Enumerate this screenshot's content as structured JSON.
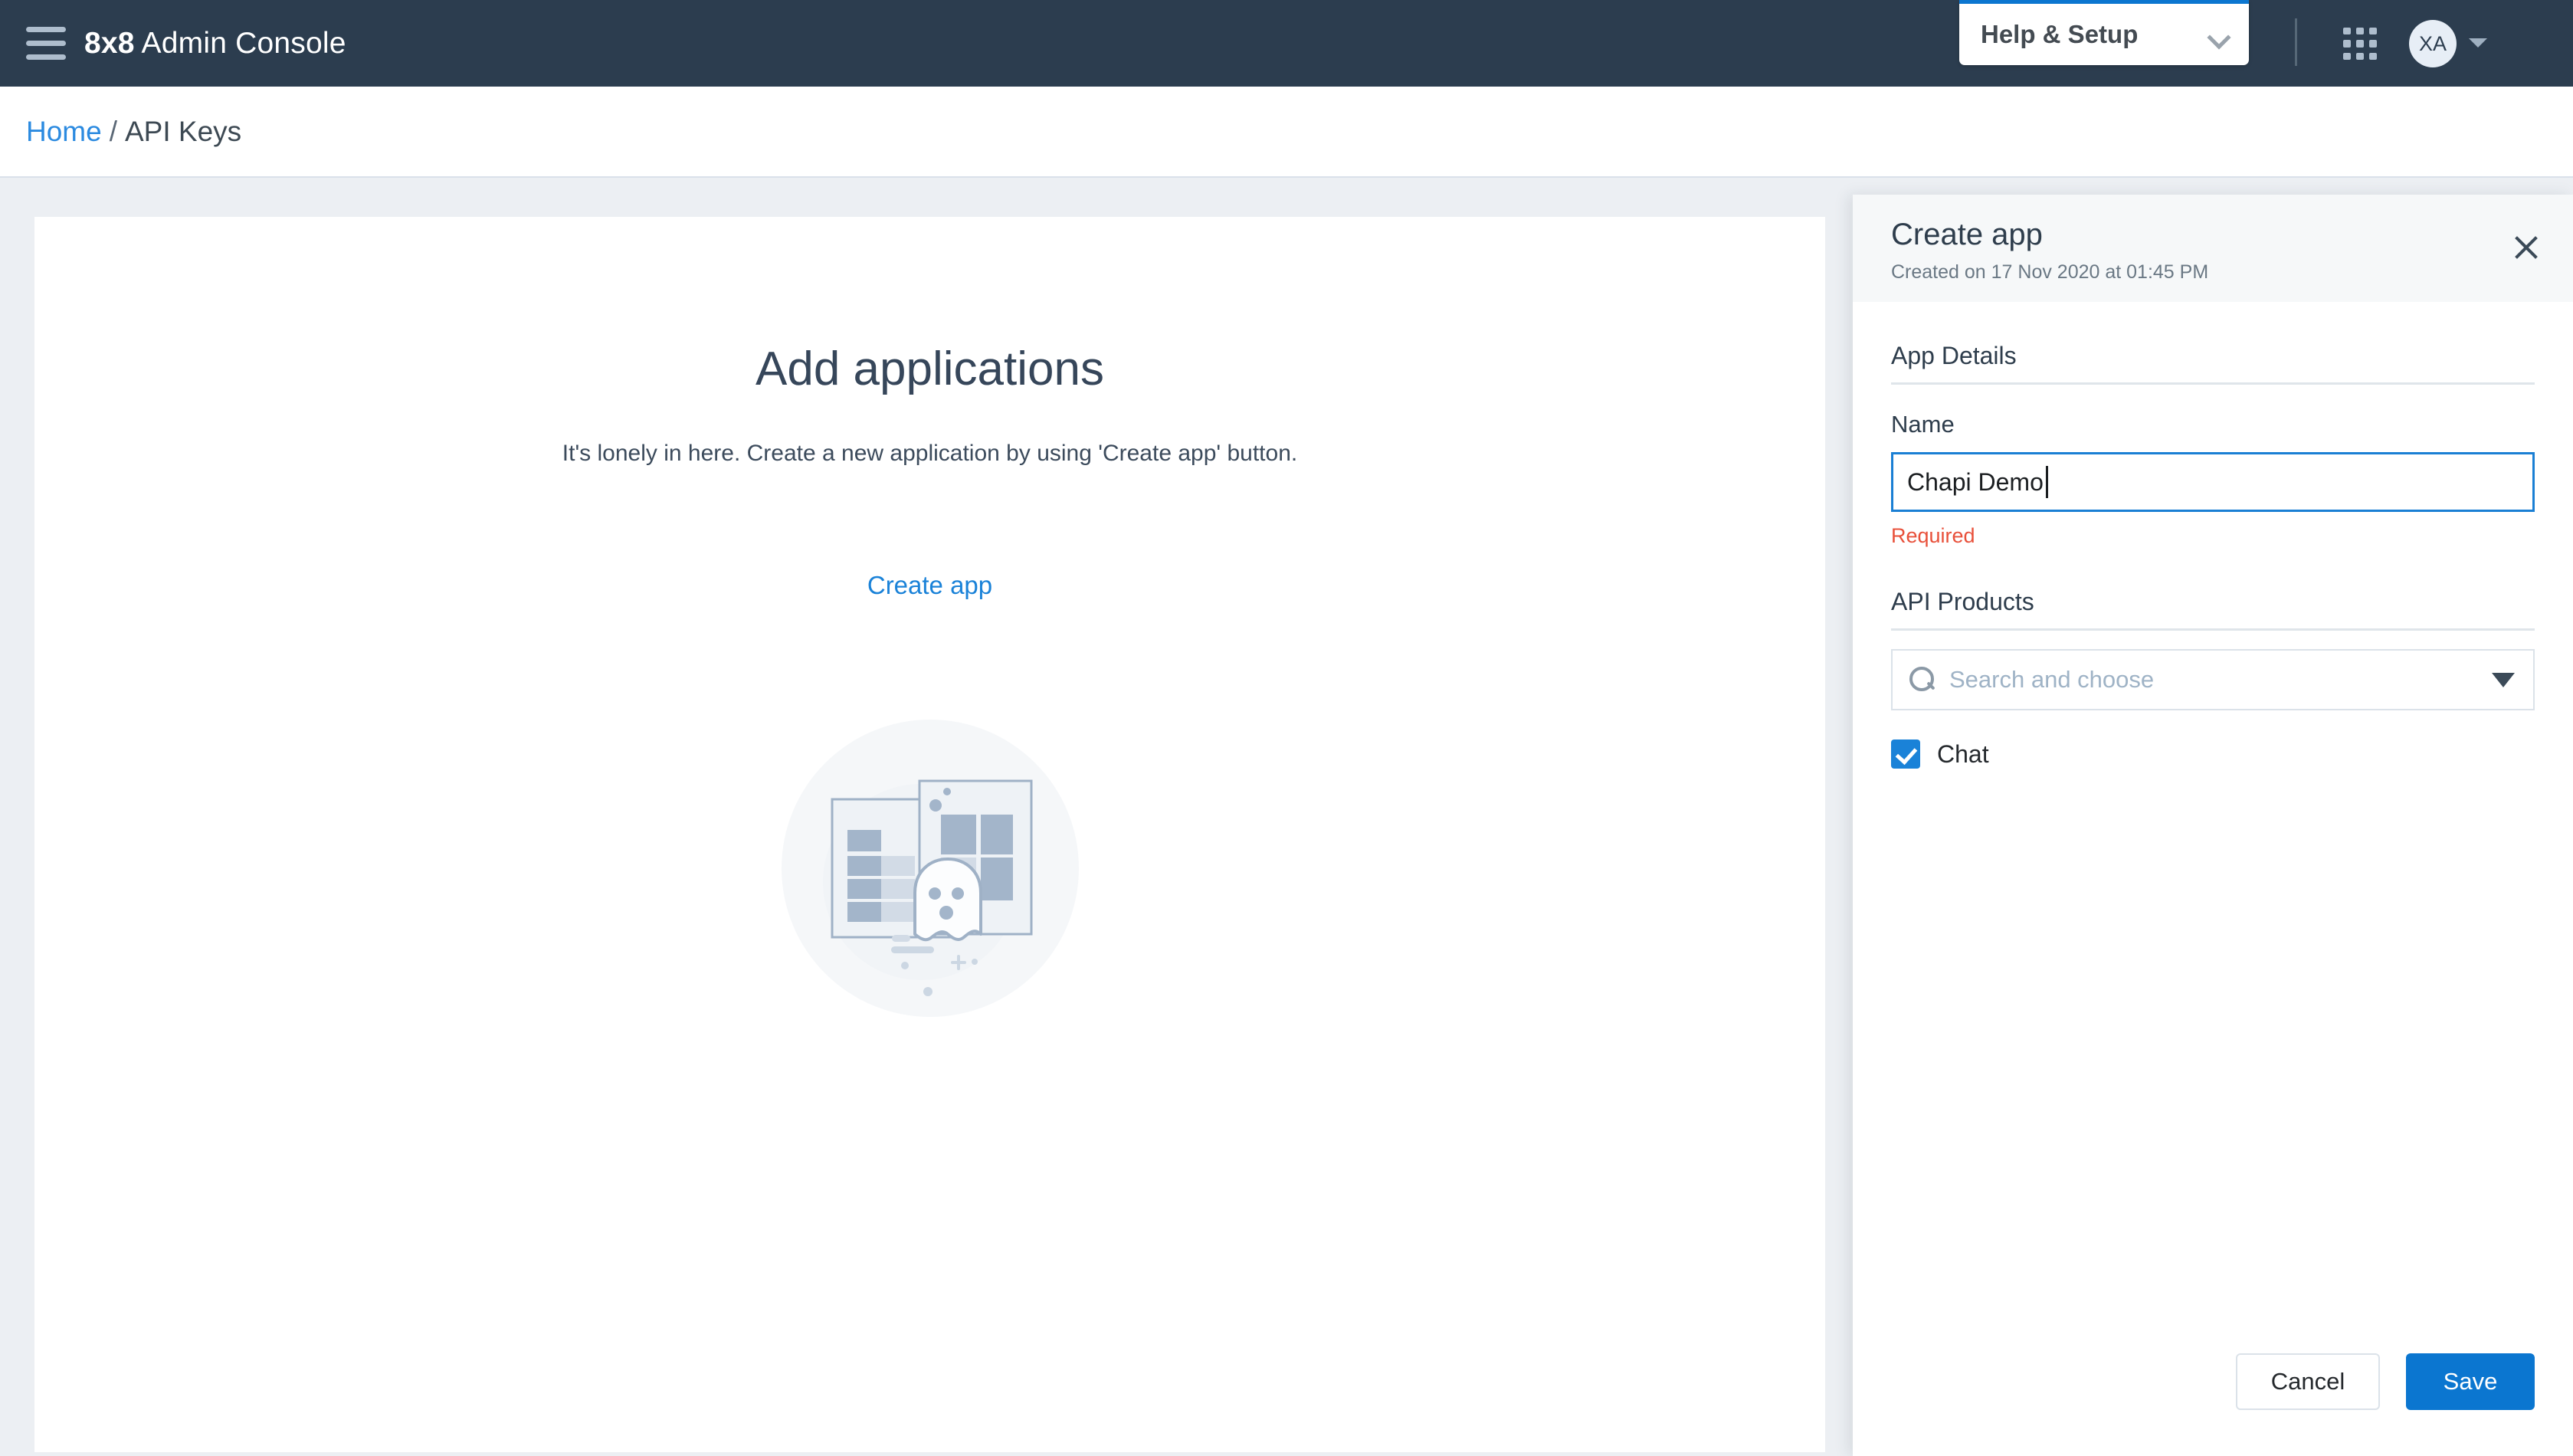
{
  "topbar": {
    "menu_icon": "hamburger-icon",
    "brand_bold": "8x8",
    "brand_light": " Admin Console",
    "help_setup_label": "Help & Setup",
    "help_setup_caret": "chevron-down-icon",
    "apps_grid_icon": "apps-grid-icon",
    "avatar_initials": "XA",
    "account_caret": "caret-down-icon"
  },
  "breadcrumb": {
    "home": "Home",
    "separator": "/",
    "current": "API Keys"
  },
  "main": {
    "empty_title": "Add applications",
    "empty_subtitle": "It's lonely in here. Create a new application by using 'Create app' button.",
    "create_app_link": "Create app",
    "illustration": "empty-state-ghost-illustration"
  },
  "panel": {
    "title": "Create app",
    "subtitle": "Created on 17 Nov 2020 at 01:45 PM",
    "close_icon": "close-icon",
    "app_details_section": "App Details",
    "name_label": "Name",
    "name_value": "Chapi Demo",
    "name_placeholder": "",
    "required_message": "Required",
    "api_products_section": "API Products",
    "search_placeholder": "Search and choose",
    "search_value": "",
    "search_icon": "search-icon",
    "dropdown_caret": "caret-down-icon",
    "products": [
      {
        "label": "Chat",
        "checked": true
      }
    ],
    "cancel_label": "Cancel",
    "save_label": "Save"
  },
  "colors": {
    "topbar_bg": "#2c3d4f",
    "page_bg": "#eceff3",
    "accent_blue": "#0b76d0",
    "link_blue": "#2b8ae0",
    "error_red": "#e8503a",
    "panel_header_bg": "#f6f8f9"
  }
}
